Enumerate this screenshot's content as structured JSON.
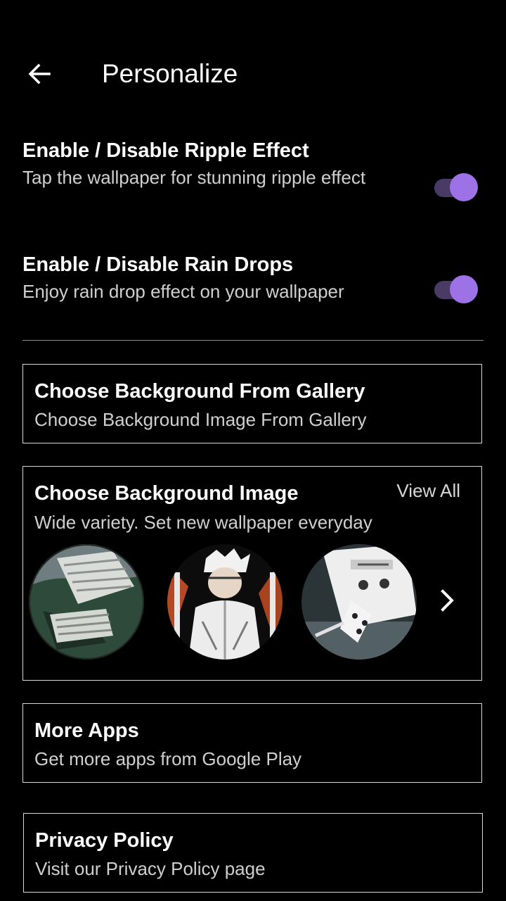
{
  "header": {
    "title": "Personalize",
    "back_icon": "arrow-left-icon"
  },
  "settings": [
    {
      "title": "Enable / Disable Ripple Effect",
      "description": "Tap the wallpaper for stunning ripple effect",
      "enabled": true
    },
    {
      "title": "Enable / Disable Rain Drops",
      "description": "Enjoy rain drop effect on your wallpaper",
      "enabled": true
    }
  ],
  "gallery_card": {
    "title": "Choose Background From Gallery",
    "description": "Choose Background Image From Gallery"
  },
  "background_card": {
    "title": "Choose Background Image",
    "description": "Wide variety. Set new wallpaper everyday",
    "view_all": "View All",
    "next_icon": "chevron-right-icon"
  },
  "more_apps_card": {
    "title": "More Apps",
    "description": "Get more apps from Google Play"
  },
  "privacy_card": {
    "title": "Privacy Policy",
    "description": "Visit our Privacy Policy page"
  },
  "colors": {
    "background": "#000000",
    "accent": "#9d72e6",
    "toggle_track": "#4a3a66",
    "card_border": "#d8d8d8"
  }
}
